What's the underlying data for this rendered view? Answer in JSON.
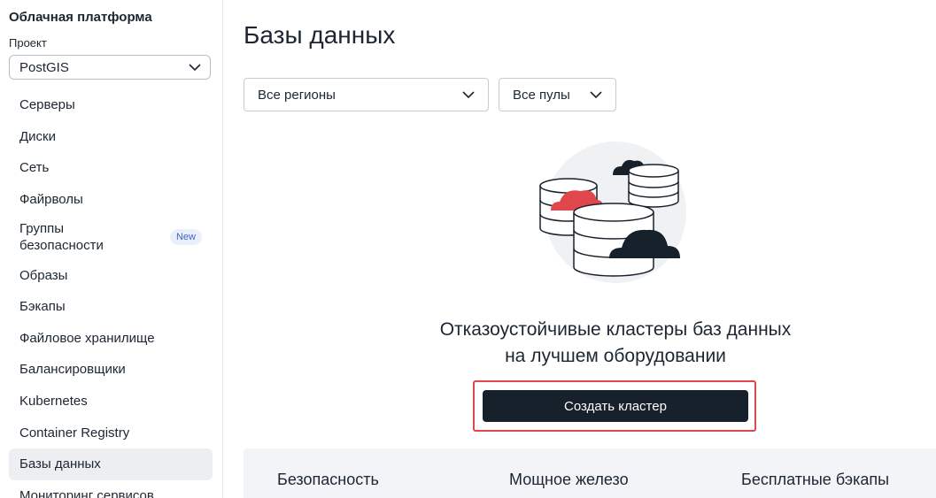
{
  "sidebar": {
    "brand": "Облачная платформа",
    "project_label": "Проект",
    "project_value": "PostGIS",
    "items": [
      {
        "label": "Серверы"
      },
      {
        "label": "Диски"
      },
      {
        "label": "Сеть"
      },
      {
        "label": "Файрволы"
      },
      {
        "label": "Группы безопасности",
        "badge": "New"
      },
      {
        "label": "Образы"
      },
      {
        "label": "Бэкапы"
      },
      {
        "label": "Файловое хранилище"
      },
      {
        "label": "Балансировщики"
      },
      {
        "label": "Kubernetes"
      },
      {
        "label": "Container Registry"
      },
      {
        "label": "Базы данных",
        "active": true
      },
      {
        "label": "Мониторинг сервисов"
      }
    ]
  },
  "main": {
    "title": "Базы данных",
    "filters": {
      "region": "Все регионы",
      "pool": "Все пулы"
    },
    "empty_state": {
      "line1": "Отказоустойчивые кластеры баз данных",
      "line2": "на лучшем оборудовании",
      "button": "Создать кластер"
    },
    "features": [
      "Безопасность",
      "Мощное железо",
      "Бесплатные бэкапы"
    ]
  },
  "colors": {
    "accent_red": "#e0474d",
    "button_dark": "#16212c",
    "text": "#1c2632",
    "active_bg": "#eceef1",
    "badge_text": "#3e63c9"
  },
  "icons": [
    "chevron-down-icon",
    "database-illustration"
  ]
}
